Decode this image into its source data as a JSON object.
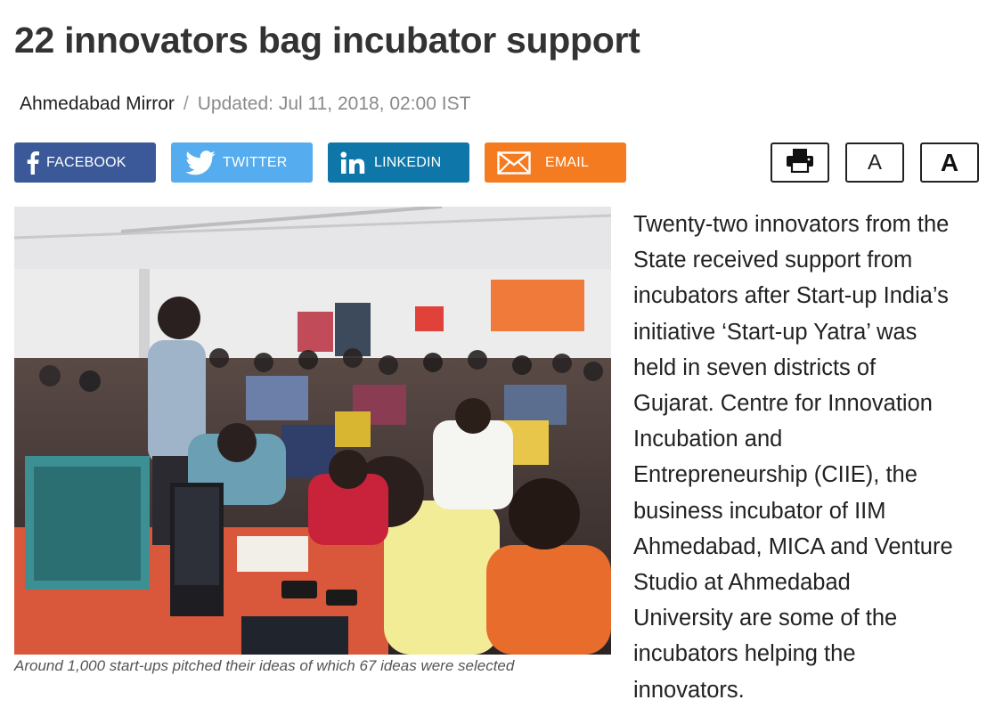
{
  "article": {
    "headline": "22 innovators bag incubator support",
    "source": "Ahmedabad Mirror",
    "separator": "/",
    "updated": "Updated: Jul 11, 2018, 02:00 IST",
    "image_caption": "Around 1,000 start-ups pitched their ideas of which 67 ideas were selected",
    "body_lines": [
      "Twenty-two innovators from the",
      "State received support from",
      "incubators after Start-up India’s",
      "initiative ‘Start-up Yatra’ was",
      "held in seven districts of",
      "Gujarat. Centre for Innovation",
      "Incubation and",
      "Entrepreneurship (CIIE), the",
      "business incubator of IIM",
      "Ahmedabad, MICA and Venture",
      "Studio at Ahmedabad",
      "University are some of the",
      "incubators helping the",
      "innovators."
    ]
  },
  "share": {
    "facebook": {
      "label": "FACEBOOK",
      "icon": "facebook-icon",
      "color": "#3b5998"
    },
    "twitter": {
      "label": "TWITTER",
      "icon": "twitter-bird-icon",
      "color": "#55acee"
    },
    "linkedin": {
      "label": "LINKEDIN",
      "icon": "linkedin-icon",
      "color": "#0e76a8"
    },
    "email": {
      "label": "EMAIL",
      "icon": "envelope-icon",
      "color": "#f47b20"
    }
  },
  "tools": {
    "print_icon": "printer-icon",
    "font_small": "A",
    "font_large": "A"
  }
}
